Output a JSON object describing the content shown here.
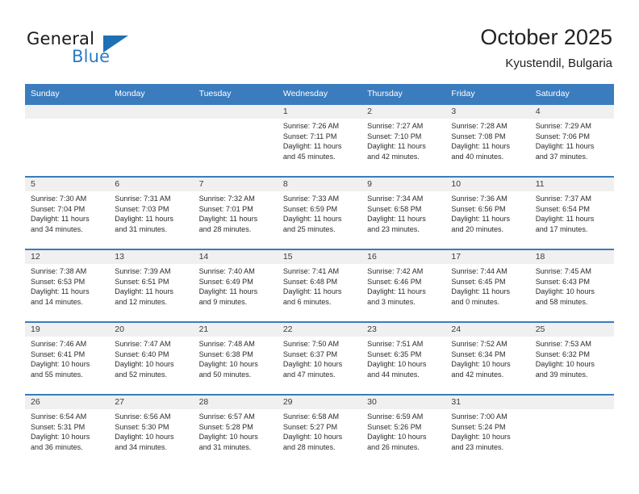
{
  "brand": {
    "name_part1": "General",
    "name_part2": "Blue",
    "triangle_icon": "triangle-icon",
    "accent_color": "#2b7cc4"
  },
  "header": {
    "month_title": "October 2025",
    "location": "Kyustendil, Bulgaria"
  },
  "theme": {
    "header_bg": "#3a7cbe",
    "date_band_bg": "#f0f0f0",
    "cell_bg": "#ffffff",
    "text_color": "#2b2b2b"
  },
  "weekday_headers": [
    "Sunday",
    "Monday",
    "Tuesday",
    "Wednesday",
    "Thursday",
    "Friday",
    "Saturday"
  ],
  "weeks": [
    [
      {
        "day": "",
        "sunrise": "",
        "sunset": "",
        "daylight_line1": "",
        "daylight_line2": ""
      },
      {
        "day": "",
        "sunrise": "",
        "sunset": "",
        "daylight_line1": "",
        "daylight_line2": ""
      },
      {
        "day": "",
        "sunrise": "",
        "sunset": "",
        "daylight_line1": "",
        "daylight_line2": ""
      },
      {
        "day": "1",
        "sunrise": "Sunrise: 7:26 AM",
        "sunset": "Sunset: 7:11 PM",
        "daylight_line1": "Daylight: 11 hours",
        "daylight_line2": "and 45 minutes."
      },
      {
        "day": "2",
        "sunrise": "Sunrise: 7:27 AM",
        "sunset": "Sunset: 7:10 PM",
        "daylight_line1": "Daylight: 11 hours",
        "daylight_line2": "and 42 minutes."
      },
      {
        "day": "3",
        "sunrise": "Sunrise: 7:28 AM",
        "sunset": "Sunset: 7:08 PM",
        "daylight_line1": "Daylight: 11 hours",
        "daylight_line2": "and 40 minutes."
      },
      {
        "day": "4",
        "sunrise": "Sunrise: 7:29 AM",
        "sunset": "Sunset: 7:06 PM",
        "daylight_line1": "Daylight: 11 hours",
        "daylight_line2": "and 37 minutes."
      }
    ],
    [
      {
        "day": "5",
        "sunrise": "Sunrise: 7:30 AM",
        "sunset": "Sunset: 7:04 PM",
        "daylight_line1": "Daylight: 11 hours",
        "daylight_line2": "and 34 minutes."
      },
      {
        "day": "6",
        "sunrise": "Sunrise: 7:31 AM",
        "sunset": "Sunset: 7:03 PM",
        "daylight_line1": "Daylight: 11 hours",
        "daylight_line2": "and 31 minutes."
      },
      {
        "day": "7",
        "sunrise": "Sunrise: 7:32 AM",
        "sunset": "Sunset: 7:01 PM",
        "daylight_line1": "Daylight: 11 hours",
        "daylight_line2": "and 28 minutes."
      },
      {
        "day": "8",
        "sunrise": "Sunrise: 7:33 AM",
        "sunset": "Sunset: 6:59 PM",
        "daylight_line1": "Daylight: 11 hours",
        "daylight_line2": "and 25 minutes."
      },
      {
        "day": "9",
        "sunrise": "Sunrise: 7:34 AM",
        "sunset": "Sunset: 6:58 PM",
        "daylight_line1": "Daylight: 11 hours",
        "daylight_line2": "and 23 minutes."
      },
      {
        "day": "10",
        "sunrise": "Sunrise: 7:36 AM",
        "sunset": "Sunset: 6:56 PM",
        "daylight_line1": "Daylight: 11 hours",
        "daylight_line2": "and 20 minutes."
      },
      {
        "day": "11",
        "sunrise": "Sunrise: 7:37 AM",
        "sunset": "Sunset: 6:54 PM",
        "daylight_line1": "Daylight: 11 hours",
        "daylight_line2": "and 17 minutes."
      }
    ],
    [
      {
        "day": "12",
        "sunrise": "Sunrise: 7:38 AM",
        "sunset": "Sunset: 6:53 PM",
        "daylight_line1": "Daylight: 11 hours",
        "daylight_line2": "and 14 minutes."
      },
      {
        "day": "13",
        "sunrise": "Sunrise: 7:39 AM",
        "sunset": "Sunset: 6:51 PM",
        "daylight_line1": "Daylight: 11 hours",
        "daylight_line2": "and 12 minutes."
      },
      {
        "day": "14",
        "sunrise": "Sunrise: 7:40 AM",
        "sunset": "Sunset: 6:49 PM",
        "daylight_line1": "Daylight: 11 hours",
        "daylight_line2": "and 9 minutes."
      },
      {
        "day": "15",
        "sunrise": "Sunrise: 7:41 AM",
        "sunset": "Sunset: 6:48 PM",
        "daylight_line1": "Daylight: 11 hours",
        "daylight_line2": "and 6 minutes."
      },
      {
        "day": "16",
        "sunrise": "Sunrise: 7:42 AM",
        "sunset": "Sunset: 6:46 PM",
        "daylight_line1": "Daylight: 11 hours",
        "daylight_line2": "and 3 minutes."
      },
      {
        "day": "17",
        "sunrise": "Sunrise: 7:44 AM",
        "sunset": "Sunset: 6:45 PM",
        "daylight_line1": "Daylight: 11 hours",
        "daylight_line2": "and 0 minutes."
      },
      {
        "day": "18",
        "sunrise": "Sunrise: 7:45 AM",
        "sunset": "Sunset: 6:43 PM",
        "daylight_line1": "Daylight: 10 hours",
        "daylight_line2": "and 58 minutes."
      }
    ],
    [
      {
        "day": "19",
        "sunrise": "Sunrise: 7:46 AM",
        "sunset": "Sunset: 6:41 PM",
        "daylight_line1": "Daylight: 10 hours",
        "daylight_line2": "and 55 minutes."
      },
      {
        "day": "20",
        "sunrise": "Sunrise: 7:47 AM",
        "sunset": "Sunset: 6:40 PM",
        "daylight_line1": "Daylight: 10 hours",
        "daylight_line2": "and 52 minutes."
      },
      {
        "day": "21",
        "sunrise": "Sunrise: 7:48 AM",
        "sunset": "Sunset: 6:38 PM",
        "daylight_line1": "Daylight: 10 hours",
        "daylight_line2": "and 50 minutes."
      },
      {
        "day": "22",
        "sunrise": "Sunrise: 7:50 AM",
        "sunset": "Sunset: 6:37 PM",
        "daylight_line1": "Daylight: 10 hours",
        "daylight_line2": "and 47 minutes."
      },
      {
        "day": "23",
        "sunrise": "Sunrise: 7:51 AM",
        "sunset": "Sunset: 6:35 PM",
        "daylight_line1": "Daylight: 10 hours",
        "daylight_line2": "and 44 minutes."
      },
      {
        "day": "24",
        "sunrise": "Sunrise: 7:52 AM",
        "sunset": "Sunset: 6:34 PM",
        "daylight_line1": "Daylight: 10 hours",
        "daylight_line2": "and 42 minutes."
      },
      {
        "day": "25",
        "sunrise": "Sunrise: 7:53 AM",
        "sunset": "Sunset: 6:32 PM",
        "daylight_line1": "Daylight: 10 hours",
        "daylight_line2": "and 39 minutes."
      }
    ],
    [
      {
        "day": "26",
        "sunrise": "Sunrise: 6:54 AM",
        "sunset": "Sunset: 5:31 PM",
        "daylight_line1": "Daylight: 10 hours",
        "daylight_line2": "and 36 minutes."
      },
      {
        "day": "27",
        "sunrise": "Sunrise: 6:56 AM",
        "sunset": "Sunset: 5:30 PM",
        "daylight_line1": "Daylight: 10 hours",
        "daylight_line2": "and 34 minutes."
      },
      {
        "day": "28",
        "sunrise": "Sunrise: 6:57 AM",
        "sunset": "Sunset: 5:28 PM",
        "daylight_line1": "Daylight: 10 hours",
        "daylight_line2": "and 31 minutes."
      },
      {
        "day": "29",
        "sunrise": "Sunrise: 6:58 AM",
        "sunset": "Sunset: 5:27 PM",
        "daylight_line1": "Daylight: 10 hours",
        "daylight_line2": "and 28 minutes."
      },
      {
        "day": "30",
        "sunrise": "Sunrise: 6:59 AM",
        "sunset": "Sunset: 5:26 PM",
        "daylight_line1": "Daylight: 10 hours",
        "daylight_line2": "and 26 minutes."
      },
      {
        "day": "31",
        "sunrise": "Sunrise: 7:00 AM",
        "sunset": "Sunset: 5:24 PM",
        "daylight_line1": "Daylight: 10 hours",
        "daylight_line2": "and 23 minutes."
      },
      {
        "day": "",
        "sunrise": "",
        "sunset": "",
        "daylight_line1": "",
        "daylight_line2": ""
      }
    ]
  ]
}
